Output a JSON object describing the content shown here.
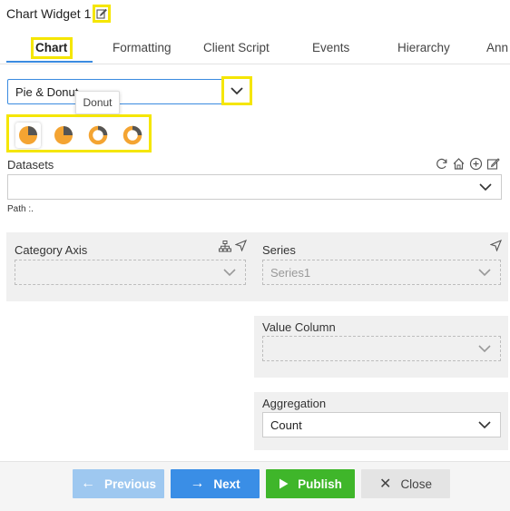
{
  "widget": {
    "title": "Chart Widget 1"
  },
  "tabs": [
    {
      "label": "Chart"
    },
    {
      "label": "Formatting"
    },
    {
      "label": "Client Script"
    },
    {
      "label": "Events"
    },
    {
      "label": "Hierarchy"
    },
    {
      "label": "Ann"
    }
  ],
  "chart_type": {
    "value": "Pie & Donut",
    "tooltip": "Donut"
  },
  "chart_icons": [
    "pie-icon",
    "pie-icon",
    "donut-icon",
    "donut-icon"
  ],
  "datasets": {
    "label": "Datasets",
    "path_label": "Path :."
  },
  "category_axis": {
    "label": "Category Axis",
    "value": ""
  },
  "series": {
    "label": "Series",
    "value": "Series1"
  },
  "value_column": {
    "label": "Value Column",
    "value": ""
  },
  "aggregation": {
    "label": "Aggregation",
    "value": "Count"
  },
  "footer": {
    "previous": "Previous",
    "next": "Next",
    "publish": "Publish",
    "close": "Close"
  },
  "colors": {
    "accent": "#3b8be0",
    "highlight": "#f5e600",
    "chart_orange": "#f4a432",
    "chart_dark": "#555555",
    "next_btn": "#3a8ee6",
    "publish_btn": "#3fb62a",
    "previous_btn": "#9ec8f0"
  }
}
